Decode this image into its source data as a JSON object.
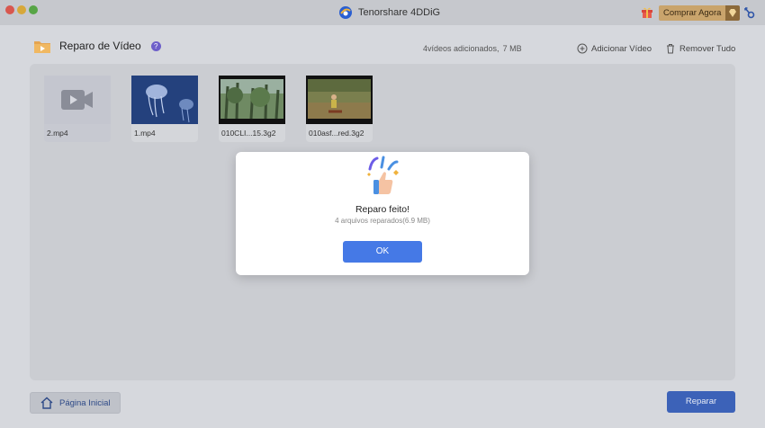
{
  "window": {
    "app_title": "Tenorshare 4DDiG",
    "buy_label": "Comprar Agora"
  },
  "header": {
    "title": "Reparo de Vídeo",
    "help_glyph": "?",
    "stats_count": "4vídeos adicionados,",
    "stats_size": "7 MB",
    "add_label": "Adicionar Vídeo",
    "remove_label": "Remover Tudo"
  },
  "files": [
    {
      "name": "2.mp4",
      "icon": "video-file-icon"
    },
    {
      "name": "1.mp4",
      "icon": "jellyfish-thumbnail"
    },
    {
      "name": "010CLI...15.3g2",
      "icon": "forest-thumbnail"
    },
    {
      "name": "010asf...red.3g2",
      "icon": "field-thumbnail"
    }
  ],
  "footer": {
    "home_label": "Página Inicial",
    "repair_label": "Reparar"
  },
  "dialog": {
    "title": "Reparo feito!",
    "subtitle": "4 arquivos reparados(6.9 MB)",
    "ok_label": "OK"
  },
  "colors": {
    "accent": "#4579e6",
    "repair_button": "#3c62b8",
    "buy_button": "#c9a46c",
    "help_badge": "#6d5fc9"
  }
}
